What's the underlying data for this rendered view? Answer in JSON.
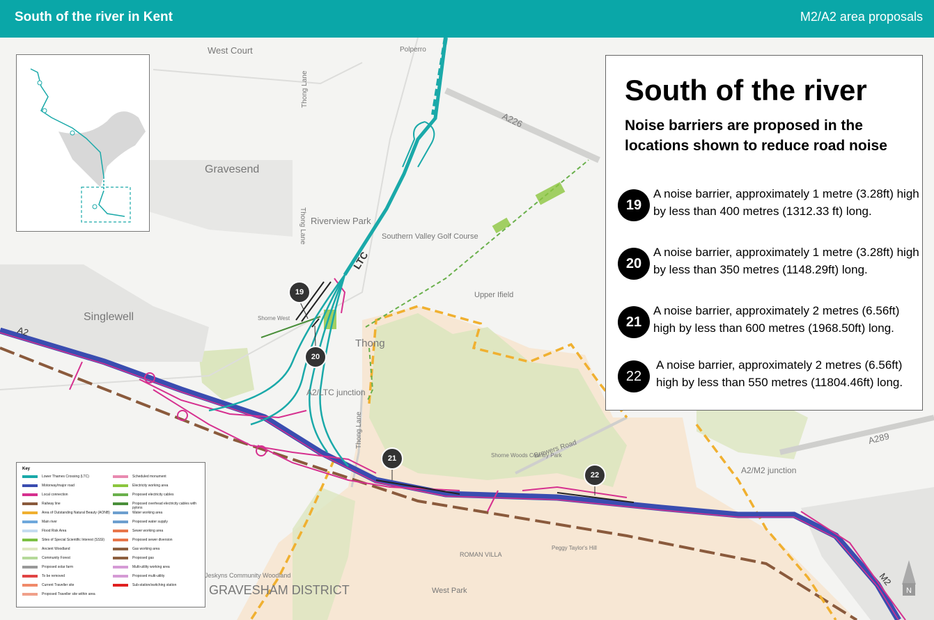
{
  "header": {
    "left_title": "South of the river in Kent",
    "right_title": "M2/A2 area proposals"
  },
  "panel": {
    "title": "South of the river",
    "subtitle": "Noise barriers are proposed in the locations shown to reduce road noise",
    "items": [
      {
        "number": "19",
        "text": "A noise barrier, approximately 1 metre (3.28ft) high by less than 400 metres (1312.33 ft) long."
      },
      {
        "number": "20",
        "text": "A noise barrier, approximately 1 metre (3.28ft) high by less than 350 metres (1148.29ft) long."
      },
      {
        "number": "21",
        "text": "A noise barrier, approximately 2 metres (6.56ft) high by less than 600 metres (1968.50ft) long."
      },
      {
        "number": "22",
        "text": "A noise barrier, approximately 2 metres (6.56ft) high by less than 550 metres (11804.46ft) long."
      }
    ]
  },
  "map_labels": {
    "west_court": "West Court",
    "gravesend": "Gravesend",
    "thong_lane_n": "Thong Lane",
    "thong_lane_w": "Thong Lane",
    "riverview_park": "Riverview Park",
    "ltc": "LTC",
    "southern_valley": "Southern Valley Golf Course",
    "a226": "A226",
    "singlewell": "Singlewell",
    "a2": "A2",
    "thong": "Thong",
    "a2_ltc_junction": "A2/LTC junction",
    "thong_lane_s": "Thong Lane",
    "upper_ifield": "Upper Ifield",
    "brewers_road": "Brewers Road",
    "a289": "A289",
    "a2_m2_junction": "A2/M2 junction",
    "m2": "M2",
    "roman_villa": "ROMAN VILLA",
    "west_park": "West Park",
    "polperro": "Polperro",
    "shorne_west": "Shorne West",
    "shorne_woods": "Shorne Woods Country Park",
    "peggy_taylors": "Peggy Taylor's Hill",
    "jeskyns": "Jeskyns Community Woodland",
    "gravesham": "GRAVESHAM DISTRICT",
    "north": "N"
  },
  "markers": [
    "19",
    "20",
    "21",
    "22"
  ],
  "legend": {
    "title": "Key",
    "items": [
      {
        "label": "Lower Thames Crossing (LTC)",
        "color": "#1aa9a9"
      },
      {
        "label": "Motorway/major road",
        "color": "#3a4db0"
      },
      {
        "label": "Local connection",
        "color": "#d6308f"
      },
      {
        "label": "Railway line",
        "color": "#8a5a3c"
      },
      {
        "label": "Area of Outstanding Natural Beauty (AONB)",
        "color": "#f0b030"
      },
      {
        "label": "Main river",
        "color": "#6fa8dc"
      },
      {
        "label": "Flood Risk Area",
        "color": "#c5dcf0"
      },
      {
        "label": "Sites of Special Scientific Interest (SSSI)",
        "color": "#7cc044"
      },
      {
        "label": "Ancient Woodland",
        "color": "#dfe8c2"
      },
      {
        "label": "Community Forest",
        "color": "#b5d99a"
      },
      {
        "label": "Proposed solar farm",
        "color": "#999999"
      },
      {
        "label": "To be removed",
        "color": "#e04444"
      },
      {
        "label": "Current Traveller site",
        "color": "#f08a6a"
      },
      {
        "label": "Proposed Traveller site within area",
        "color": "#f0a08a"
      },
      {
        "label": "Scheduled monument",
        "color": "#e88ab0"
      },
      {
        "label": "Electricity working area",
        "color": "#8cc63e"
      },
      {
        "label": "Proposed electricity cables",
        "color": "#6ab04c"
      },
      {
        "label": "Proposed overhead electricity cables with pylons",
        "color": "#4a8f3a"
      },
      {
        "label": "Water working area",
        "color": "#6d9fcf"
      },
      {
        "label": "Proposed water supply",
        "color": "#6d9fcf"
      },
      {
        "label": "Sewer working area",
        "color": "#e8764a"
      },
      {
        "label": "Proposed sewer diversion",
        "color": "#e8764a"
      },
      {
        "label": "Gas working area",
        "color": "#8d6040"
      },
      {
        "label": "Proposed gas",
        "color": "#8d6040"
      },
      {
        "label": "Multi-utility working area",
        "color": "#d59ad5"
      },
      {
        "label": "Proposed multi-utility",
        "color": "#d59ad5"
      },
      {
        "label": "Sub-station/switching station",
        "color": "#e02020"
      }
    ]
  }
}
